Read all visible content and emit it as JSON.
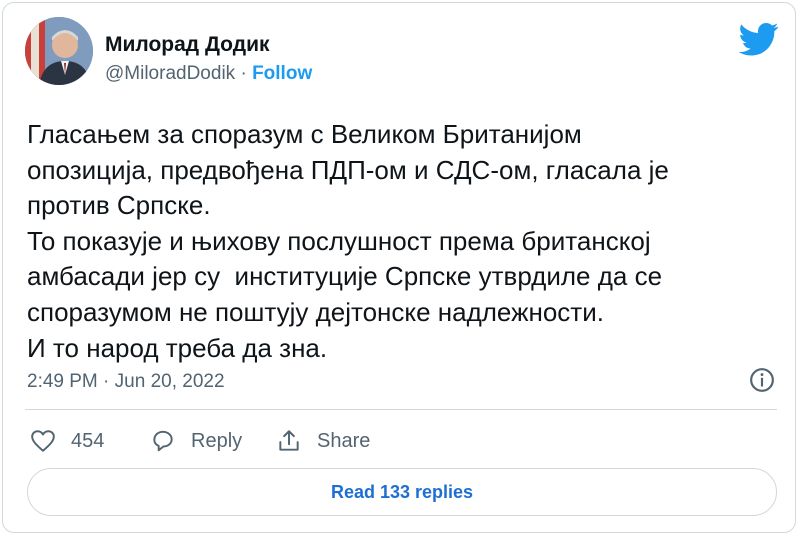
{
  "author": {
    "name": "Милорад Додик",
    "handle": "@MiloradDodik",
    "separator": "·",
    "follow_label": "Follow"
  },
  "tweet": {
    "lines": [
      "Гласањем за споразум с Великом Британијом",
      "опозиција, предвођена ПДП-ом и СДС-ом, гласала је",
      "против Српске.",
      "То показује и њихову послушност према британској",
      "амбасади јер су  институције Српске утврдиле да се",
      "споразумом не поштују дејтонске надлежности.",
      "И то народ треба да зна."
    ],
    "time": "2:49 PM",
    "date": "Jun 20, 2022",
    "time_separator": "·"
  },
  "actions": {
    "like_count": "454",
    "reply_label": "Reply",
    "share_label": "Share"
  },
  "read_replies_label": "Read 133 replies",
  "icons": [
    "twitter-logo-icon",
    "info-icon",
    "heart-icon",
    "reply-bubble-icon",
    "share-icon"
  ],
  "colors": {
    "accent": "#1d9bf0",
    "text": "#0f1419",
    "secondary": "#536471",
    "border": "#cfd9de"
  }
}
